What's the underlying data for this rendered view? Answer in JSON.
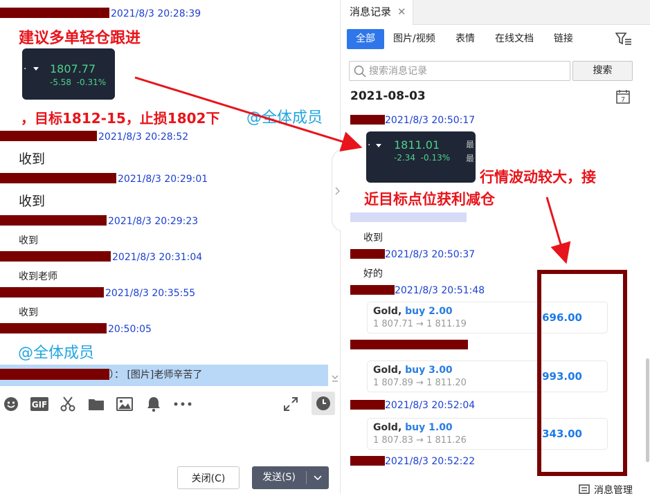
{
  "left_chat": {
    "messages": [
      {
        "time": "2021/8/3 20:28:39",
        "text": "建议多单轻仓跟进",
        "image": {
          "price": "1807.77",
          "change": "-5.58",
          "change_pct": "-0.31%"
        },
        "text2": "，目标1812-15，止损1802下",
        "mention": "@全体成员"
      },
      {
        "time": "2021/8/3 20:28:52",
        "text": "收到"
      },
      {
        "time": "2021/8/3 20:29:01",
        "text": "收到"
      },
      {
        "time": "2021/8/3 20:29:23",
        "text": "收到"
      },
      {
        "time": "2021/8/3 20:31:04",
        "text": "收到老师"
      },
      {
        "time": "2021/8/3 20:35:55",
        "text": "收到"
      },
      {
        "time": "20:50:05",
        "mention": "@全体成员"
      }
    ],
    "preview_bar": "）：  [图片]老师辛苦了",
    "toolbar": {
      "icons": [
        "emoji-icon",
        "gif-icon",
        "scissors-icon",
        "folder-icon",
        "image-icon",
        "bell-icon",
        "more-icon",
        "expand-icon",
        "history-icon"
      ]
    },
    "buttons": {
      "close": "关闭(C)",
      "send": "发送(S)"
    }
  },
  "right_panel": {
    "tab_title": "消息记录",
    "filters": [
      "全部",
      "图片/视频",
      "表情",
      "在线文档",
      "链接"
    ],
    "search_placeholder": "搜索消息记录",
    "search_button": "搜索",
    "date_heading": "2021-08-03",
    "calendar_day": "7",
    "messages": [
      {
        "time": "2021/8/3 20:50:17",
        "image": {
          "price": "1811.01",
          "change": "-2.34",
          "change_pct": "-0.13%",
          "side_label": "最"
        }
      },
      {
        "time": "",
        "text": "收到"
      },
      {
        "time": "2021/8/3 20:50:37",
        "text": "好的"
      },
      {
        "time": "2021/8/3 20:51:48",
        "trade": {
          "symbol": "Gold",
          "action": "buy 2.00",
          "from": "1 807.71",
          "to": "1 811.19",
          "profit": "696.00"
        }
      },
      {
        "time": "",
        "trade": {
          "symbol": "Gold",
          "action": "buy 3.00",
          "from": "1 807.89",
          "to": "1 811.20",
          "profit": "993.00"
        }
      },
      {
        "time": "2021/8/3 20:52:04",
        "trade": {
          "symbol": "Gold",
          "action": "buy 1.00",
          "from": "1 807.83",
          "to": "1 811.26",
          "profit": "343.00"
        }
      },
      {
        "time": "2021/8/3 20:52:22"
      }
    ],
    "manage_label": "消息管理"
  },
  "annotations": {
    "left_red_1": "建议多单轻仓跟进",
    "left_red_2": "，目标1812-15，止损1802下",
    "right_red_line1": "行情波动较大，接",
    "right_red_line2": "近目标点位获利减仓"
  },
  "colors": {
    "accent_blue": "#2f76ea",
    "time_blue": "#1a3fd1",
    "annotation_red": "#e8141b",
    "redaction": "#7a0000",
    "price_green": "#4dd28a"
  }
}
